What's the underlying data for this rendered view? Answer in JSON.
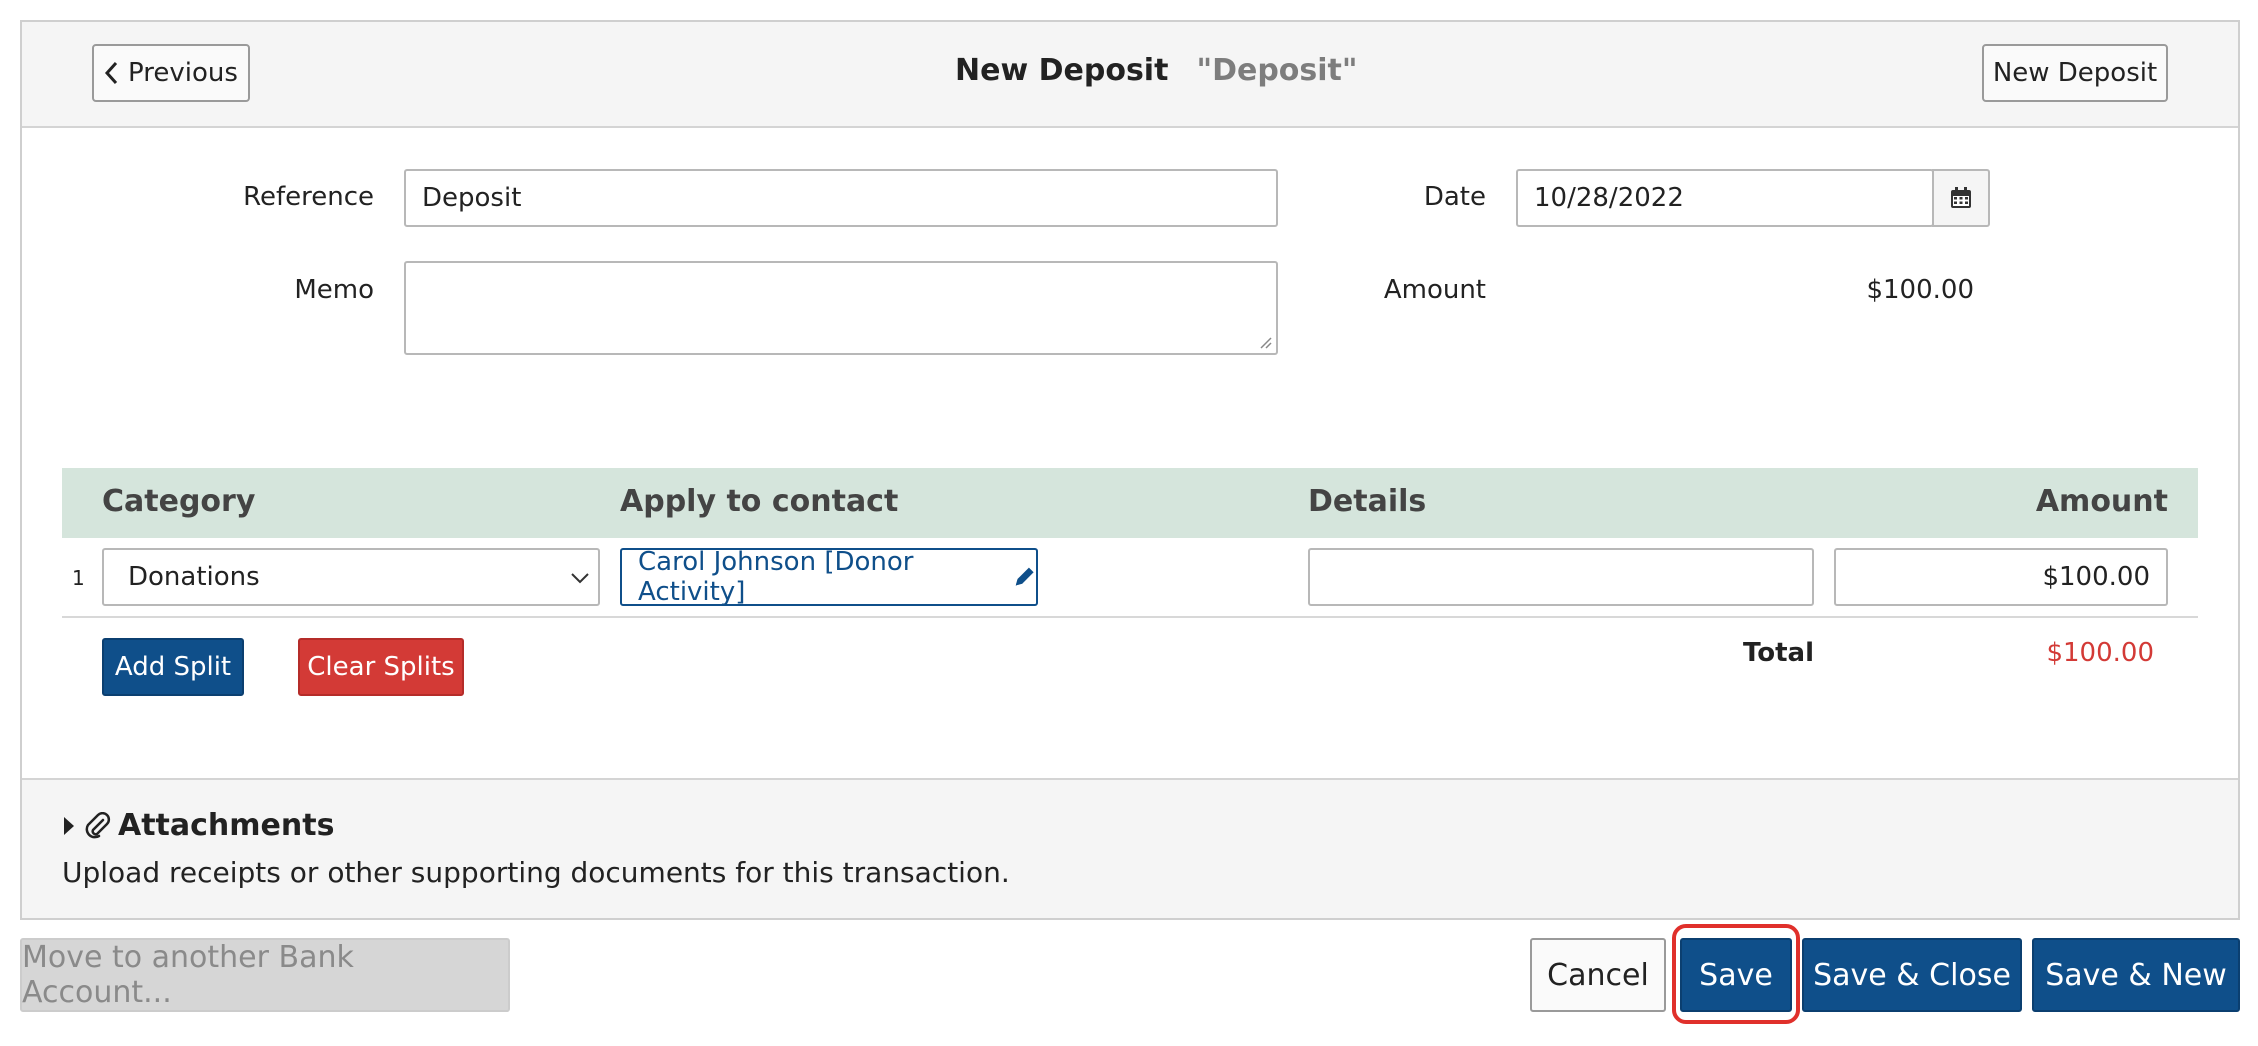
{
  "header": {
    "previous_label": "Previous",
    "title": "New Deposit",
    "subtitle": "\"Deposit\"",
    "new_deposit_label": "New Deposit"
  },
  "form": {
    "reference_label": "Reference",
    "reference_value": "Deposit",
    "memo_label": "Memo",
    "memo_value": "",
    "date_label": "Date",
    "date_value": "10/28/2022",
    "amount_label": "Amount",
    "amount_value": "$100.00"
  },
  "splits": {
    "headers": {
      "category": "Category",
      "contact": "Apply to contact",
      "details": "Details",
      "amount": "Amount"
    },
    "rows": [
      {
        "index": "1",
        "category": "Donations",
        "contact": "Carol Johnson [Donor Activity]",
        "details": "",
        "amount": "$100.00"
      }
    ],
    "add_split_label": "Add Split",
    "clear_splits_label": "Clear Splits",
    "total_label": "Total",
    "total_value": "$100.00"
  },
  "attachments": {
    "title": "Attachments",
    "description": "Upload receipts or other supporting documents for this transaction."
  },
  "footer": {
    "move_label": "Move to another Bank Account...",
    "cancel_label": "Cancel",
    "save_label": "Save",
    "save_close_label": "Save & Close",
    "save_new_label": "Save & New"
  },
  "colors": {
    "primary": "#0f4f8a",
    "danger": "#d33a36",
    "total_red": "#d33a36",
    "grid_header": "#d5e5dc",
    "highlight": "#e0302b"
  }
}
